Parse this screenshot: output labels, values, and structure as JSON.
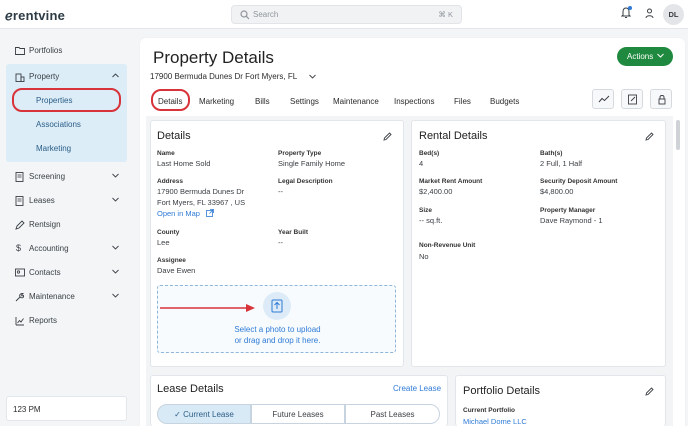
{
  "brand": {
    "logo_text": "ℯrentvine"
  },
  "topbar": {
    "search_placeholder": "Search",
    "search_shortcut": "⌘ K",
    "avatar_initials": "DL",
    "icons": [
      "search-icon",
      "bell-icon",
      "person-icon"
    ]
  },
  "sidebar": {
    "items": [
      {
        "label": "Portfolios",
        "icon": "folder-icon"
      },
      {
        "label": "Property",
        "icon": "building-icon"
      },
      {
        "label": "Screening",
        "icon": "document-icon"
      },
      {
        "label": "Leases",
        "icon": "document-icon"
      },
      {
        "label": "Rentsign",
        "icon": "pen-icon"
      },
      {
        "label": "Accounting",
        "icon": "dollar-icon"
      },
      {
        "label": "Contacts",
        "icon": "contact-card-icon"
      },
      {
        "label": "Maintenance",
        "icon": "wrench-icon"
      },
      {
        "label": "Reports",
        "icon": "chart-icon"
      }
    ],
    "property_sub": [
      "Properties",
      "Associations",
      "Marketing"
    ],
    "time": "123 PM"
  },
  "page": {
    "title": "Property Details",
    "address": "17900 Bermuda Dunes Dr Fort Myers, FL",
    "actions_label": "Actions",
    "tabs": [
      "Details",
      "Marketing",
      "Bills",
      "Settings",
      "Maintenance",
      "Inspections",
      "Files",
      "Budgets"
    ]
  },
  "details": {
    "title": "Details",
    "name_label": "Name",
    "name_value": "Last Home Sold",
    "property_type_label": "Property Type",
    "property_type_value": "Single Family Home",
    "address_label": "Address",
    "address_line1": "17900 Bermuda Dunes Dr",
    "address_line2": "Fort Myers, FL 33967 , US",
    "open_in_map": "Open in Map",
    "legal_label": "Legal Description",
    "legal_value": "--",
    "county_label": "County",
    "county_value": "Lee",
    "year_built_label": "Year Built",
    "year_built_value": "--",
    "assignee_label": "Assignee",
    "assignee_value": "Dave Ewen",
    "upload_line1": "Select a photo to upload",
    "upload_line2": "or drag and drop it here."
  },
  "rental": {
    "title": "Rental Details",
    "beds_label": "Bed(s)",
    "beds_value": "4",
    "baths_label": "Bath(s)",
    "baths_value": "2 Full, 1 Half",
    "market_rent_label": "Market Rent Amount",
    "market_rent_value": "$2,400.00",
    "deposit_label": "Security Deposit Amount",
    "deposit_value": "$4,800.00",
    "size_label": "Size",
    "size_value": "-- sq.ft.",
    "manager_label": "Property Manager",
    "manager_value": "Dave Raymond - 1",
    "nonrev_label": "Non-Revenue Unit",
    "nonrev_value": "No"
  },
  "lease": {
    "title": "Lease Details",
    "create_label": "Create Lease",
    "segments": [
      "Current Lease",
      "Future Leases",
      "Past Leases"
    ]
  },
  "portfolio": {
    "title": "Portfolio Details",
    "current_label": "Current Portfolio",
    "current_value": "Michael Dome LLC"
  },
  "colors": {
    "accent_green": "#1f8a3f",
    "highlight_red": "#d8333a",
    "link_blue": "#2f7bd6"
  }
}
